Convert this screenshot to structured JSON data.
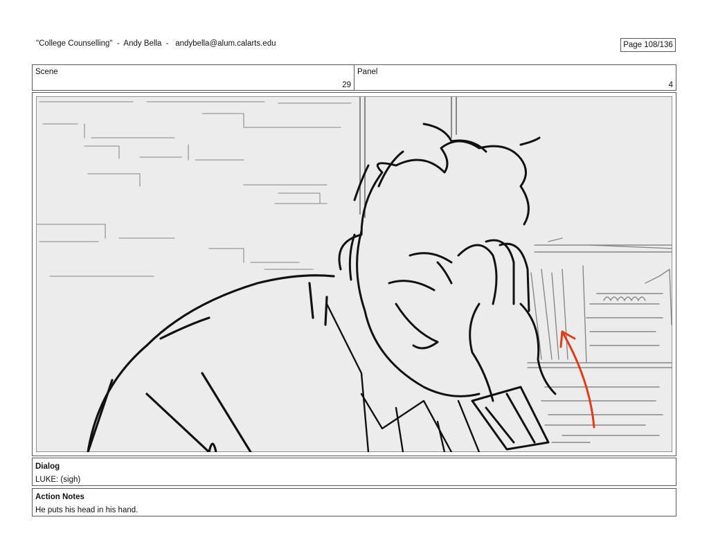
{
  "header": {
    "info": "\"College Counselling\"  -  Andy Bella  -   andybella@alum.calarts.edu",
    "page": "Page 108/136"
  },
  "scene": {
    "label": "Scene",
    "value": "29"
  },
  "panel": {
    "label": "Panel",
    "value": "4"
  },
  "dialog": {
    "label": "Dialog",
    "text": "LUKE: (sigh)"
  },
  "action_notes": {
    "label": "Action Notes",
    "text": "He puts his head in his hand."
  },
  "colors": {
    "accent_arrow": "#e23a14",
    "background_fill": "#ececec",
    "line": "#111111"
  }
}
